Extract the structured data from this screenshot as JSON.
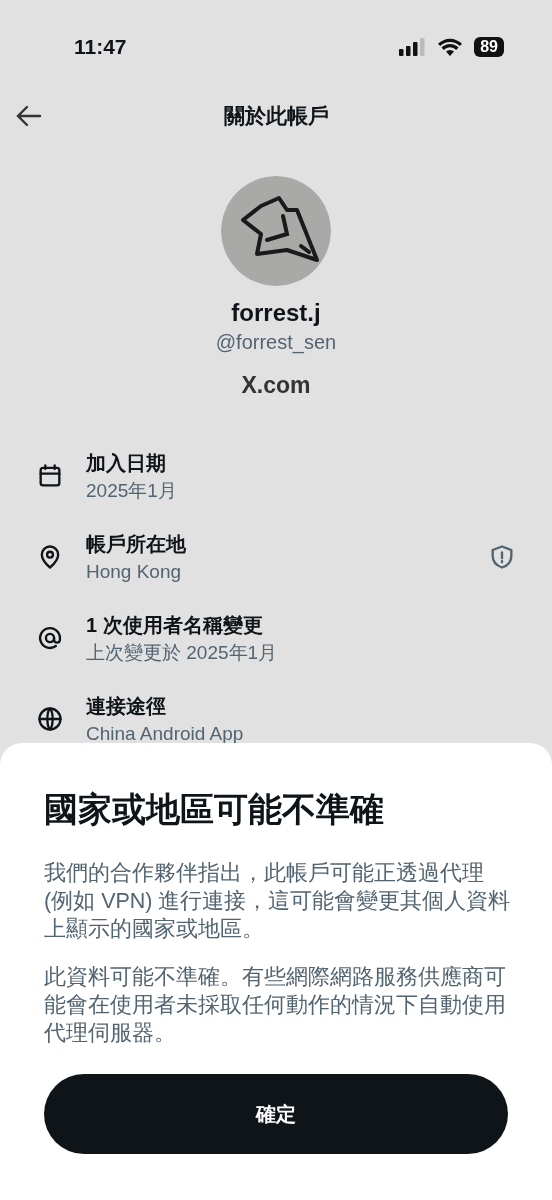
{
  "status_bar": {
    "time": "11:47",
    "battery": "89"
  },
  "header": {
    "title": "關於此帳戶"
  },
  "profile": {
    "name": "forrest.j",
    "handle": "@forrest_sen",
    "site": "X.com"
  },
  "details": [
    {
      "kind": "calendar",
      "label": "加入日期",
      "value": "2025年1月",
      "warning": false
    },
    {
      "kind": "location",
      "label": "帳戶所在地",
      "value": "Hong Kong",
      "warning": true
    },
    {
      "kind": "at",
      "label": "1 次使用者名稱變更",
      "value": "上次變更於 2025年1月",
      "warning": false
    },
    {
      "kind": "globe",
      "label": "連接途徑",
      "value": "China Android App",
      "warning": false
    }
  ],
  "sheet": {
    "title": "國家或地區可能不準確",
    "paragraphs": [
      "我們的合作夥伴指出，此帳戶可能正透過代理 (例如 VPN) 進行連接，這可能會變更其個人資料上顯示的國家或地區。",
      "此資料可能不準確。有些網際網路服務供應商可能會在使用者未採取任何動作的情況下自動使用代理伺服器。"
    ],
    "button": "確定"
  }
}
